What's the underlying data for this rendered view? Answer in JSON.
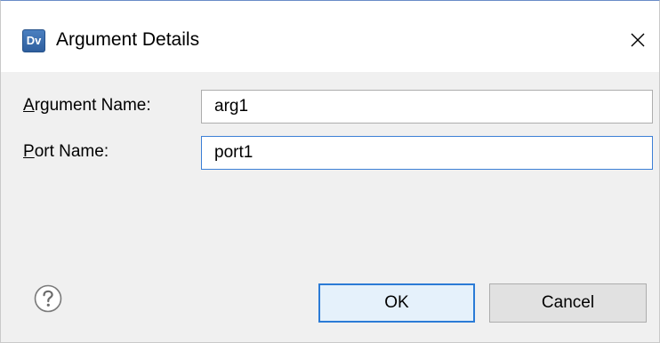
{
  "dialog": {
    "title": "Argument Details",
    "app_icon_text": "Dv"
  },
  "fields": {
    "argument_name": {
      "label_accel": "A",
      "label_rest": "rgument Name:",
      "value": "arg1"
    },
    "port_name": {
      "label_accel": "P",
      "label_rest": "ort Name:",
      "value": "port1"
    }
  },
  "buttons": {
    "ok": "OK",
    "cancel": "Cancel"
  },
  "icons": {
    "close": "close-icon",
    "help": "help-icon",
    "app": "app-icon"
  },
  "colors": {
    "focus_border": "#3c7fd6",
    "default_button_border": "#2b7bd6",
    "default_button_bg": "#e5f1fb",
    "app_icon_bg": "#3b6fb0"
  }
}
